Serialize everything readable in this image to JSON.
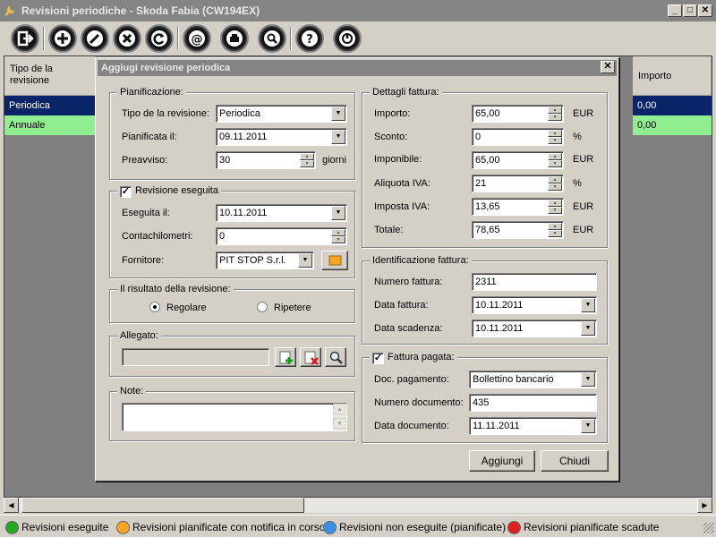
{
  "window": {
    "title": "Revisioni periodiche - Skoda Fabia (CW194EX)",
    "min": "_",
    "max": "□",
    "close": "✕"
  },
  "toolbar": {
    "items": [
      "exit-icon",
      "add-icon",
      "edit-icon",
      "delete-icon",
      "refresh-icon",
      "email-icon",
      "print-icon",
      "search-icon",
      "help-icon",
      "info-icon"
    ]
  },
  "grid": {
    "headers": [
      "Tipo de la revisione",
      "Importo"
    ],
    "rows": [
      {
        "tipo": "Periodica",
        "importo": "0,00",
        "color": "#0a246a"
      },
      {
        "tipo": "Annuale",
        "importo": "0,00",
        "color": "#90ee90"
      }
    ]
  },
  "dialog": {
    "title": "Aggiugi revisione periodica",
    "close": "✕",
    "pianificazione": {
      "title": "Pianificazione:",
      "tipo_label": "Tipo de la revisione:",
      "tipo_value": "Periodica",
      "pianificata_label": "Pianificata il:",
      "pianificata_value": "09.11.2011",
      "preavviso_label": "Preavviso:",
      "preavviso_value": "30",
      "preavviso_unit": "giorni"
    },
    "revisione_eseguita": {
      "title": "Revisione eseguita",
      "checked": true,
      "check": "✓",
      "eseguita_label": "Eseguita il:",
      "eseguita_value": "10.11.2011",
      "contachilometri_label": "Contachilometri:",
      "contachilometri_value": "0",
      "fornitore_label": "Fornitore:",
      "fornitore_value": "PIT STOP S.r.l."
    },
    "risultato": {
      "title": "Il risultato della revisione:",
      "regolare": "Regolare",
      "ripetere": "Ripetere",
      "selected": "Regolare"
    },
    "allegato": {
      "title": "Allegato:",
      "value": ""
    },
    "note": {
      "title": "Note:",
      "value": ""
    },
    "dettagli": {
      "title": "Dettagli fattura:",
      "importo_label": "Importo:",
      "importo_value": "65,00",
      "importo_unit": "EUR",
      "sconto_label": "Sconto:",
      "sconto_value": "0",
      "sconto_unit": "%",
      "imponibile_label": "Imponibile:",
      "imponibile_value": "65,00",
      "imponibile_unit": "EUR",
      "aliquota_label": "Aliquota IVA:",
      "aliquota_value": "21",
      "aliquota_unit": "%",
      "imposta_label": "Imposta IVA:",
      "imposta_value": "13,65",
      "imposta_unit": "EUR",
      "totale_label": "Totale:",
      "totale_value": "78,65",
      "totale_unit": "EUR"
    },
    "identificazione": {
      "title": "Identificazione fattura:",
      "numero_label": "Numero fattura:",
      "numero_value": "2311",
      "data_label": "Data fattura:",
      "data_value": "10.11.2011",
      "scadenza_label": "Data scadenza:",
      "scadenza_value": "10.11.2011"
    },
    "pagata": {
      "title": "Fattura pagata:",
      "checked": true,
      "check": "✓",
      "doc_label": "Doc. pagamento:",
      "doc_value": "Bollettino bancario",
      "numdoc_label": "Numero documento:",
      "numdoc_value": "435",
      "datadoc_label": "Data documento:",
      "datadoc_value": "11.11.2011"
    },
    "buttons": {
      "aggiungi": "Aggiungi",
      "chiudi": "Chiudi"
    }
  },
  "statusbar": {
    "legend": [
      {
        "label": "Revisioni eseguite",
        "color": "#22aa22"
      },
      {
        "label": "Revisioni pianificate con notifica in corso",
        "color": "#f5a623"
      },
      {
        "label": "Revisioni non eseguite (pianificate)",
        "color": "#3a8ee6"
      },
      {
        "label": "Revisioni pianificate scadute",
        "color": "#e02020"
      }
    ]
  }
}
